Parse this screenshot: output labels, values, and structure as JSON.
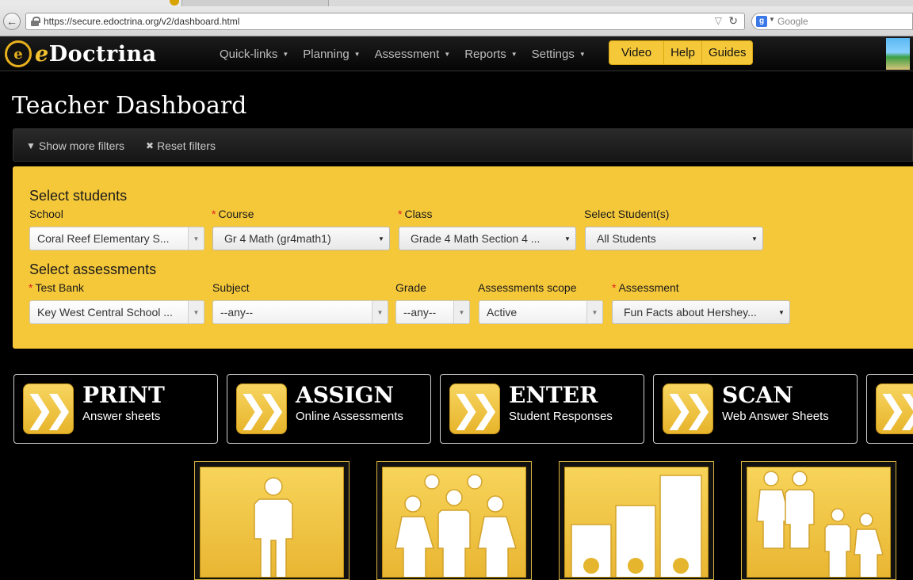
{
  "browser": {
    "url": "https://secure.edoctrina.org/v2/dashboard.html",
    "search_placeholder": "Google"
  },
  "navbar": {
    "brand_prefix": "e",
    "brand_rest": "Doctrina",
    "menu": [
      "Quick-links",
      "Planning",
      "Assessment",
      "Reports",
      "Settings"
    ],
    "help_buttons": [
      "Video",
      "Help",
      "Guides"
    ]
  },
  "page": {
    "title": "Teacher Dashboard",
    "show_filters": "Show more filters",
    "reset_filters": "Reset filters"
  },
  "students": {
    "title": "Select students",
    "school_label": "School",
    "school_value": "Coral Reef Elementary S...",
    "course_label": "Course",
    "course_value": "Gr 4 Math (gr4math1)",
    "class_label": "Class",
    "class_value": "Grade 4 Math Section 4 ...",
    "student_label": "Select Student(s)",
    "student_value": "All Students"
  },
  "assessments": {
    "title": "Select assessments",
    "bank_label": "Test Bank",
    "bank_value": "Key West Central School ...",
    "subject_label": "Subject",
    "subject_value": "--any--",
    "grade_label": "Grade",
    "grade_value": "--any--",
    "scope_label": "Assessments scope",
    "scope_value": "Active",
    "assessment_label": "Assessment",
    "assessment_value": "Fun Facts about Hershey..."
  },
  "actions": [
    {
      "title": "PRINT",
      "subtitle": "Answer sheets"
    },
    {
      "title": "ASSIGN",
      "subtitle": "Online Assessments"
    },
    {
      "title": "ENTER",
      "subtitle": "Student Responses"
    },
    {
      "title": "SCAN",
      "subtitle": "Web Answer Sheets"
    }
  ],
  "tiles": [
    "single-student-icon",
    "student-group-icon",
    "ranking-podium-icon",
    "family-icon"
  ]
}
